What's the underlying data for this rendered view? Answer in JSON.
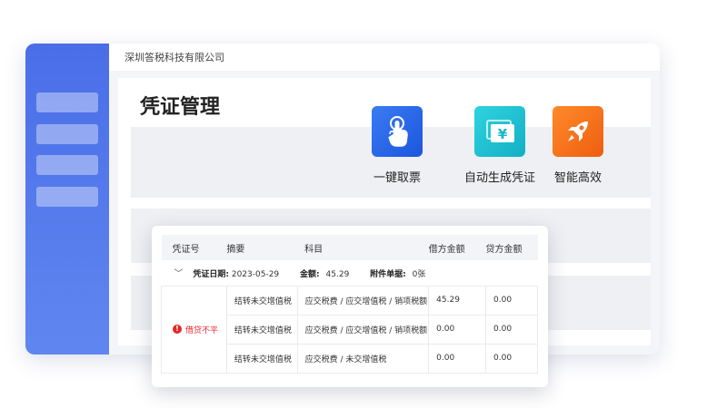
{
  "app": {
    "company": "深圳答税科技有限公司"
  },
  "sidebar": {
    "items": [
      "",
      "",
      "",
      ""
    ]
  },
  "page": {
    "title": "凭证管理"
  },
  "features": [
    {
      "label": "一键取票",
      "icon": "tap-hand-icon",
      "color": "#2a64e8"
    },
    {
      "label": "自动生成凭证",
      "icon": "voucher-yen-icon",
      "color": "#1bc1d1"
    },
    {
      "label": "智能高效",
      "icon": "rocket-icon",
      "color": "#f26a1b"
    }
  ],
  "voucher": {
    "columns": [
      "凭证号",
      "摘要",
      "科目",
      "借方金额",
      "贷方金额"
    ],
    "date_label": "凭证日期:",
    "date_value": "2023-05-29",
    "amount_label": "金额:",
    "amount_value": "45.29",
    "attach_label": "附件单据:",
    "attach_value": "0张",
    "status": "借贷不平",
    "rows": [
      {
        "summary": "结转未交增值税",
        "account": "应交税费 / 应交增值税 / 销项税额",
        "debit": "45.29",
        "credit": "0.00"
      },
      {
        "summary": "结转未交增值税",
        "account": "应交税费 / 应交增值税 / 销项税额",
        "debit": "0.00",
        "credit": "0.00"
      },
      {
        "summary": "结转未交增值税",
        "account": "应交税费 / 未交增值税",
        "debit": "0.00",
        "credit": "0.00"
      }
    ]
  },
  "colors": {
    "sidebar": "#4a6ee8",
    "error": "#e6262c"
  }
}
